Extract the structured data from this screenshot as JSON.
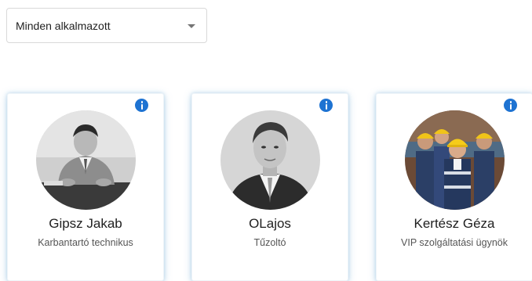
{
  "filter": {
    "selected": "Minden alkalmazott"
  },
  "employees": [
    {
      "name": "Gipsz Jakab",
      "role": "Karbantartó technikus",
      "photo_icon": "person-at-desk-photo"
    },
    {
      "name": "OLajos",
      "role": "Tűzoltó",
      "photo_icon": "person-portrait-photo"
    },
    {
      "name": "Kertész Géza",
      "role": "VIP szolgáltatási ügynök",
      "photo_icon": "workers-group-photo"
    }
  ],
  "colors": {
    "info_button": "#1e73d2",
    "card_glow": "#78afd7"
  }
}
